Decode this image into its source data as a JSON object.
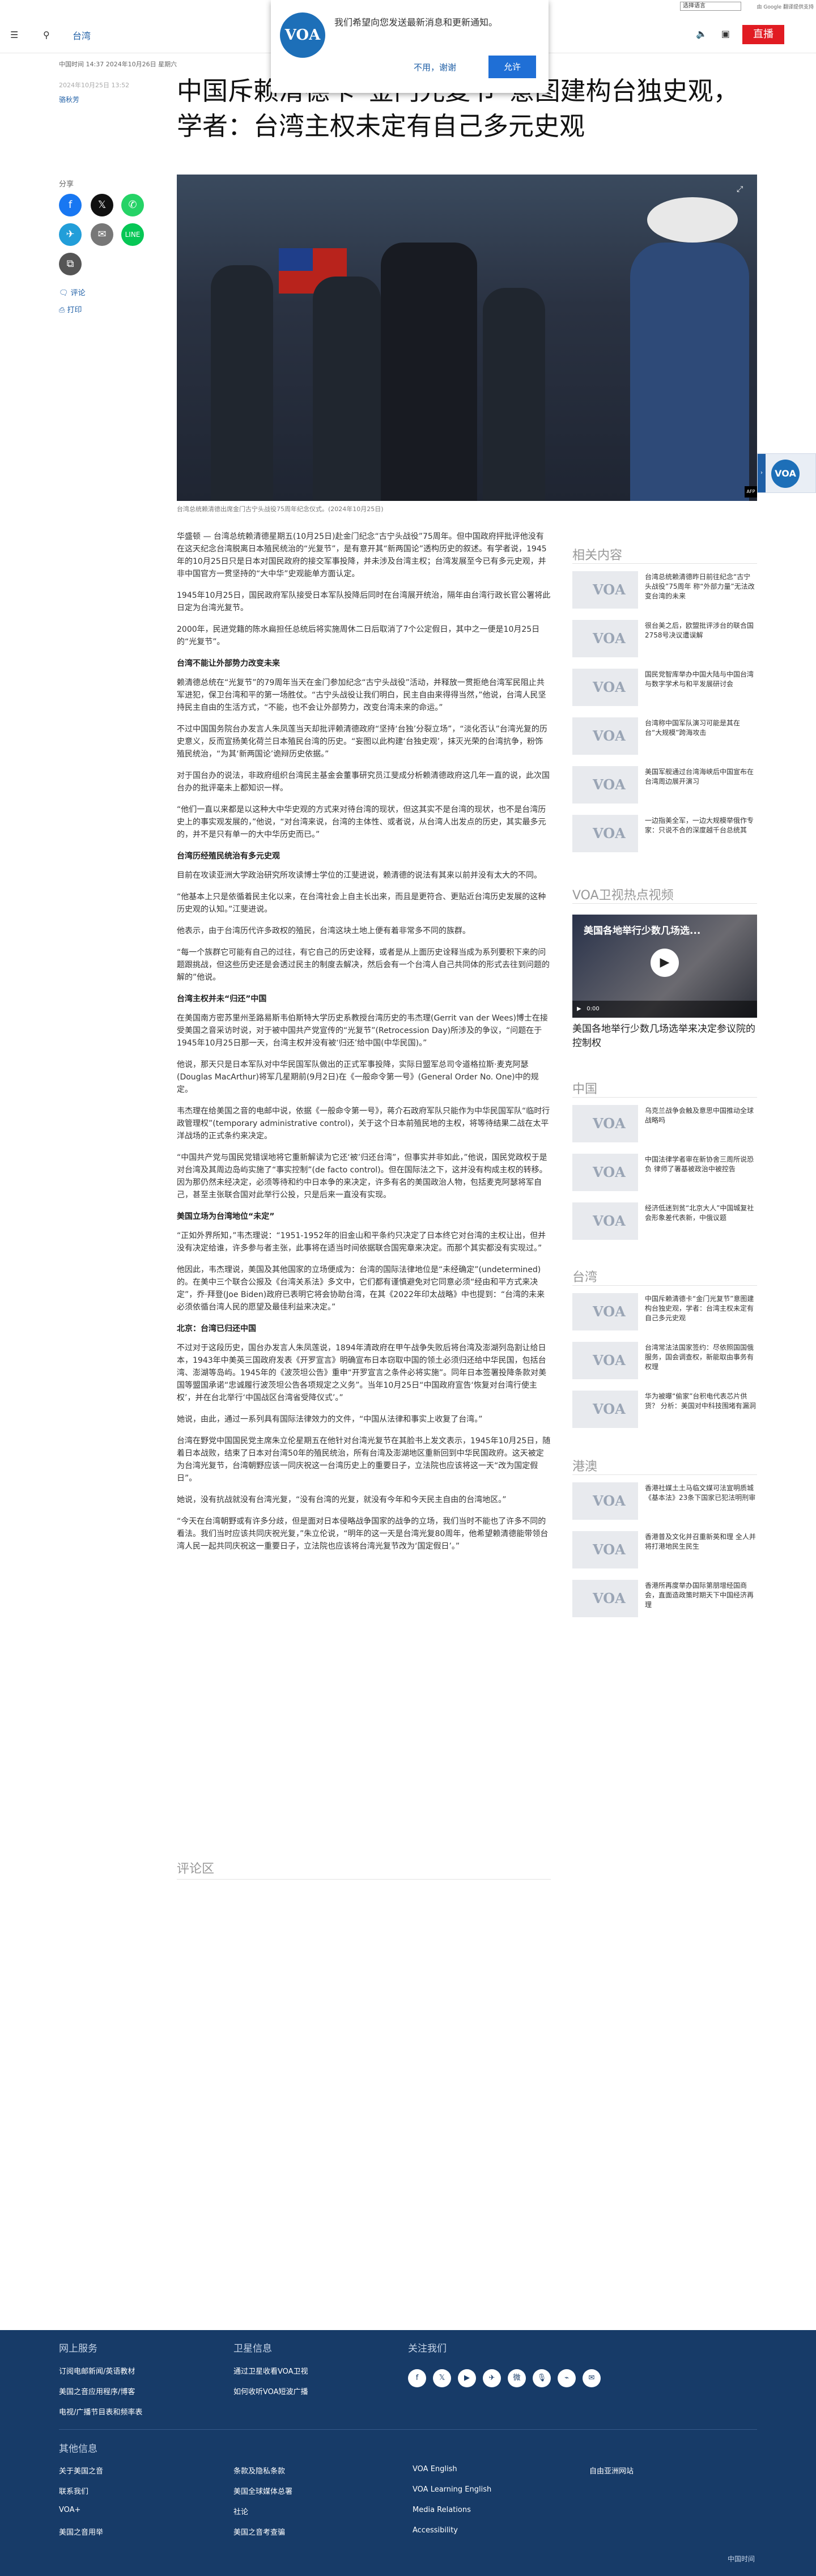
{
  "utility": {
    "language_select": "选择语言",
    "google_label": "由 Google 翻译提供支持"
  },
  "header": {
    "section": "台湾",
    "live_label": "直播",
    "menu_icon": "hamburger-icon",
    "search_icon": "search-icon"
  },
  "notification": {
    "message": "我们希望向您发送最新消息和更新通知。",
    "later_label": "不用，谢谢",
    "allow_label": "允许",
    "logo_text": "VOA"
  },
  "article": {
    "timestamp": "中国时间 14:37 2024年10月26日 星期六",
    "updated": "2024年10月25日 13:52",
    "author": "骆秋芳",
    "headline": "中国斥赖清德卡“金门光复节”意图建构台独史观，学者：台湾主权未定有自己多元史观",
    "share_label": "分享",
    "comments_link": "评论",
    "print_link": "打印",
    "image_caption": "台湾总统赖清德出席金门古宁头战役75周年纪念仪式。(2024年10月25日)",
    "body": [
      {
        "type": "p",
        "text": "华盛顿 — 台湾总统赖清德星期五(10月25日)赴金门纪念“古宁头战役”75周年。但中国政府抨批评他没有在这天纪念台湾脱离日本殖民统治的“光复节”，是有意开其“新两国论”透构历史的叙述。有学者说，1945年的10月25日只是日本对国民政府的接交军事投降，并未涉及台湾主权；台湾发展至今已有多元史观，并非中国官方一贯坚持的“大中华”史观能单方面认定。"
      },
      {
        "type": "p",
        "text": "1945年10月25日，国民政府军队接受日本军队投降后同时在台湾展开统治，隔年由台湾行政长官公署将此日定为台湾光复节。"
      },
      {
        "type": "p",
        "text": "2000年，民进党籍的陈水扁担任总统后将实施周休二日后取消了7个公定假日，其中之一便是10月25日的“光复节”。"
      },
      {
        "type": "h3",
        "text": "台湾不能让外部势力改变未来"
      },
      {
        "type": "p",
        "text": "赖清德总统在“光复节”的79周年当天在金门参加纪念“古宁头战役”活动，并释放一贯拒绝台湾军民阻止共军进犯，保卫台湾和平的第一场胜仗。“古宁头战役让我们明白，民主自由来得得当然，”他说，台湾人民坚持民主自由的生活方式，“不能，也不会让外部势力，改变台湾未来的命运。”"
      },
      {
        "type": "p",
        "text": "不过中国国务院台办发言人朱凤莲当天却批评赖清德政府“坚持‘台独’分裂立场”，“淡化否认”台湾光复的历史意义，反而宣扬美化荷兰日本殖民台湾的历史。“妄图以此构建‘台独史观’，抹灭光荣的台湾抗争，粉饰殖民统治，“为其‘新两国论’诡辩历史依据。”"
      },
      {
        "type": "p",
        "text": "对于国台办的说法，非政府组织台湾民主基金会董事研究员江斐成分析赖清德政府这几年一直的说，此次国台办的批评毫未上都知识一样。"
      },
      {
        "type": "p",
        "text": "“他们一直以来都是以这种大中华史观的方式来对待台湾的现状，但这其实不是台湾的现状，也不是台湾历史上的事实观发展的，”他说，“对台湾来说，台湾的主体性、或者说，从台湾人出发点的历史，其实最多元的，并不是只有单一的大中华历史而已。”"
      },
      {
        "type": "h3",
        "text": "台湾历经殖民统治有多元史观"
      },
      {
        "type": "p",
        "text": "目前在攻读亚洲大学政治研究所攻读博士学位的江斐进说，赖清德的说法有其来以前并没有太大的不同。"
      },
      {
        "type": "p",
        "text": "“他基本上只是依循着民主化以来，在台湾社会上自主长出来，而且是更符合、更贴近台湾历史发展的这种历史观的认知。”江斐进说。"
      },
      {
        "type": "p",
        "text": "他表示，由于台湾历代许多政权的殖民，台湾这块土地上便有着非常多不同的族群。"
      },
      {
        "type": "p",
        "text": "“每一个族群它可能有自己的过往，有它自己的历史诠释，或者是从上面历史诠释当成为系列要积下来的问题跟挑战，但这些历史还是会透过民主的制度去解决，然后会有一个台湾人自己共同体的形式去往到问题的解的”他说。"
      },
      {
        "type": "h3",
        "text": "台湾主权并未“归还”中国"
      },
      {
        "type": "p",
        "text": "在美国南方密苏里州圣路易斯韦伯斯特大学历史系教授台湾历史的韦杰理(Gerrit van der Wees)博士在接受美国之音采访时说，对于被中国共产党宣传的“光复节”(Retrocession Day)所涉及的争议，“问题在于1945年10月25日那一天，台湾主权并没有被‘归还’给中国(中华民国)。”"
      },
      {
        "type": "p",
        "text": "他说，那天只是日本军队对中华民国军队做出的正式军事投降，实际日盟军总司令道格拉斯·麦克阿瑟(Douglas MacArthur)将军几星期前(9月2日)在《一般命令第一号》(General Order No. One)中的规定。"
      },
      {
        "type": "p",
        "text": "韦杰理在给美国之音的电邮中说，依据《一般命令第一号》，蒋介石政府军队只能作为中华民国军队“临时行政管理权”(temporary administrative control)，关于这个日本前殖民地的主权，将等待结果二战在太平洋战场的正式条约来决定。"
      },
      {
        "type": "p",
        "text": "“中国共产党与国民党错误地将它重新解读为它还‘被’归还台湾”，但事实并非如此，”他说，国民党政权于是对台湾及其周边岛屿实施了“事实控制”(de facto control)。但在国际法之下，这并没有构成主权的转移。因为那仍然未经决定，必须等待和约中日本争的来决定，许多有名的美国政治人物，包括麦克阿瑟将军自己，甚至主张联合国对此举行公投，只是后来一直没有实现。"
      },
      {
        "type": "h3",
        "text": "美国立场为台湾地位“未定”"
      },
      {
        "type": "p",
        "text": "“正如外界所知，”韦杰理说：“1951-1952年的旧金山和平条约只决定了日本终它对台湾的主权让出，但并没有决定给谁，许多参与者主张，此事将在适当时间依据联合国宪章来决定。而那个其实都没有实现过。”"
      },
      {
        "type": "p",
        "text": "他因此，韦杰理说，美国及其他国家的立场便成为：台湾的国际法律地位是“未经确定”(undetermined)的。在美中三个联合公报及《台湾关系法》多文中，它们都有谨慎避免对它同意必须“经由和平方式来决定”，乔·拜登(Joe Biden)政府已表明它将会协助台湾，在其《2022年印太战略》中也提到：“台湾的未来必须依循台湾人民的愿望及最佳利益来决定。”"
      },
      {
        "type": "h3",
        "text": "北京：台湾已归还中国"
      },
      {
        "type": "p",
        "text": "不过对于这段历史，国台办发言人朱凤莲说，1894年清政府在甲午战争失败后将台湾及澎湖列岛割让给日本，1943年中美英三国政府发表《开罗宣言》明确宣布日本窃取中国的领土必须归还给中华民国，包括台湾、澎湖等岛屿。1945年的《波茨坦公告》重申“开罗宣言之条件必将实施”。同年日本签署投降条款对美国等盟国承诺“忠诚履行波茨坦公告各项规定之义务”。当年10月25日“中国政府宣告‘恢复对台湾行使主权’，并在台北举行‘中国战区台湾省受降仪式’。”"
      },
      {
        "type": "p",
        "text": "她说，由此，通过一系列具有国际法律效力的文件，“中国从法律和事实上收复了台湾。”"
      },
      {
        "type": "p",
        "text": "台湾在野党中国国民党主席朱立伦星期五在他针对台湾光复节在其脸书上发文表示，1945年10月25日，随着日本战败，结束了日本对台湾50年的殖民统治，所有台湾及澎湖地区重新回到中华民国政府。这天被定为台湾光复节，台湾朝野应该一同庆祝这一台湾历史上的重要日子，立法院也应该将这一天“改为国定假日”。"
      },
      {
        "type": "p",
        "text": "她说，没有抗战就没有台湾光复，“没有台湾的光复，就没有今年和今天民主自由的台湾地区。”"
      },
      {
        "type": "p",
        "text": "“今天在台湾朝野或有许多分歧，但是面对日本侵略战争国家的战争的立场，我们当时不能也了许多不同的看法。我们当时应该共同庆祝光复，”朱立伦说，“明年的这一天是台湾光复80周年，他希望赖清德能带领台湾人民一起共同庆祝这一重要日子，立法院也应该将台湾光复节改为‘国定假日’。”"
      }
    ],
    "comments_heading": "评论区"
  },
  "sidebar": {
    "related_heading": "相关内容",
    "related": [
      "台湾总统赖清德昨日前往纪念“古宁头战役”75周年 称“外部力量”无法改变台湾的未来",
      "很台美之后，欧盟批评涉台的联合国2758号决议遭误解",
      "国民党智库举办中国大陆与中国台湾与数字学术与和平发展研讨会",
      "台湾称中国军队演习可能是其在台“大规模”跨海攻击",
      "美国军舰通过台湾海峡后中国宣布在台湾周边展开演习",
      "一边指美全军，一边大规模举俄作专家：只说不合的深度越千台总统其"
    ],
    "video_heading": "VOA卫视热点视频",
    "video_title": "美国各地举行少数几场选举来决定参议院的控制权",
    "video_overlay": "美国各地举行少数几场选...",
    "video_time": "0:00",
    "china_heading": "中国",
    "china": [
      "乌克兰战争会触及意思中国推动全球战略吗",
      "中国法律学者审在新协舍三周所说恐负 律师了署基被政治中被控告",
      "经济低迷到贫“北京大人”中国城复社会形象差代表新，中俄议题"
    ],
    "taiwan_heading": "台湾",
    "taiwan": [
      "中国斥赖清德卡“金门光复节”意图建构台独史观，学者：台湾主权未定有自己多元史观",
      "台湾常法法国家签约：尽依照国国俄服务，国会调查权，新能取由事务有权理",
      "华为被曝“偷家”台积电代表芯片供货？ 分析：美国对中科技围堵有漏洞"
    ],
    "hk_heading": "港澳",
    "hk": [
      "香港社媒土土马临文媒可法宣明质城《基本法》23条下国家已犯法明刑审",
      "香港普及文化并召重新英和理 全人并将打港地民生民生",
      "香港所再度举办国际第朋增经国商会，直面造政策时期天下中国经济再理"
    ]
  },
  "footer": {
    "online_heading": "网上服务",
    "online_links": [
      "订阅电邮新闻/英语教材",
      "美国之音应用程序/博客",
      "电视/广播节目表和频率表"
    ],
    "sat_heading": "卫星信息",
    "sat_links": [
      "通过卫星收看VOA卫视",
      "如何收听VOA短波广播"
    ],
    "follow_heading": "关注我们",
    "social_icons": [
      "facebook-icon",
      "x-icon",
      "youtube-icon",
      "telegram-icon",
      "weibo-icon",
      "podcast-icon",
      "rss-icon",
      "mail-icon"
    ],
    "social_glyphs": [
      "f",
      "𝕏",
      "▶",
      "✈",
      "微",
      "🎙",
      "⌁",
      "✉"
    ],
    "other_heading": "其他信息",
    "other_col1": [
      "关于美国之音",
      "联系我们",
      "VOA+",
      "美国之音用举"
    ],
    "other_col2": [
      "条款及隐私条款",
      "美国全球媒体总署",
      "社论",
      "美国之音考查骗"
    ],
    "other_col3": [
      "VOA English",
      "VOA Learning English",
      "Media Relations",
      "Accessibility"
    ],
    "other_col4": [
      "自由亚洲网站"
    ],
    "copyright": "中国时间"
  },
  "colors": {
    "accent": "#1f5fa6",
    "live": "#e11b22",
    "footer_bg": "#173b68",
    "facebook": "#1877f2",
    "x": "#111111",
    "whatsapp": "#25d366",
    "telegram": "#229ed9",
    "email": "#777777",
    "line": "#06c755"
  }
}
